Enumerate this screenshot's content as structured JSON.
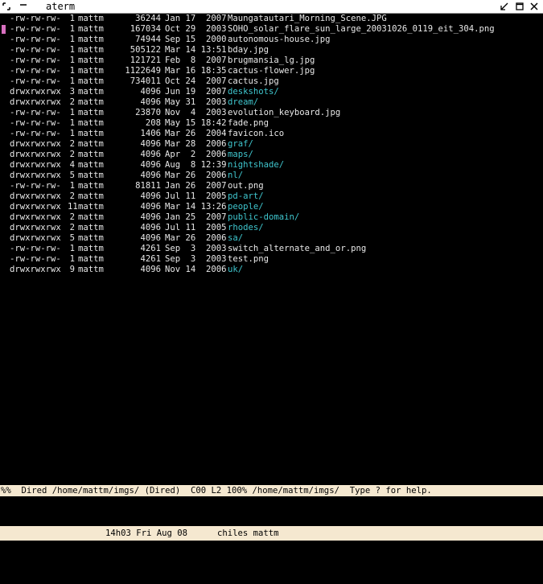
{
  "window": {
    "title": "aterm"
  },
  "listing": [
    {
      "perms": "-rw-rw-rw-",
      "links": "1",
      "owner": "mattm",
      "size": "36244",
      "date": "Jan 17  2007",
      "name": "Maungatautari_Morning_Scene.JPG",
      "dir": false
    },
    {
      "perms": "-rw-rw-rw-",
      "links": "1",
      "owner": "mattm",
      "size": "167034",
      "date": "Oct 29  2003",
      "name": "SOHO_solar_flare_sun_large_20031026_0119_eit_304.png",
      "dir": false
    },
    {
      "perms": "-rw-rw-rw-",
      "links": "1",
      "owner": "mattm",
      "size": "74944",
      "date": "Sep 15  2000",
      "name": "autonomous-house.jpg",
      "dir": false
    },
    {
      "perms": "-rw-rw-rw-",
      "links": "1",
      "owner": "mattm",
      "size": "505122",
      "date": "Mar 14 13:51",
      "name": "bday.jpg",
      "dir": false
    },
    {
      "perms": "-rw-rw-rw-",
      "links": "1",
      "owner": "mattm",
      "size": "121721",
      "date": "Feb  8  2007",
      "name": "brugmansia_lg.jpg",
      "dir": false
    },
    {
      "perms": "-rw-rw-rw-",
      "links": "1",
      "owner": "mattm",
      "size": "1122649",
      "date": "Mar 16 18:35",
      "name": "cactus-flower.jpg",
      "dir": false
    },
    {
      "perms": "-rw-rw-rw-",
      "links": "1",
      "owner": "mattm",
      "size": "734011",
      "date": "Oct 24  2007",
      "name": "cactus.jpg",
      "dir": false
    },
    {
      "perms": "drwxrwxrwx",
      "links": "3",
      "owner": "mattm",
      "size": "4096",
      "date": "Jun 19  2007",
      "name": "deskshots/",
      "dir": true
    },
    {
      "perms": "drwxrwxrwx",
      "links": "2",
      "owner": "mattm",
      "size": "4096",
      "date": "May 31  2003",
      "name": "dream/",
      "dir": true
    },
    {
      "perms": "-rw-rw-rw-",
      "links": "1",
      "owner": "mattm",
      "size": "23870",
      "date": "Nov  4  2003",
      "name": "evolution_keyboard.jpg",
      "dir": false
    },
    {
      "perms": "-rw-rw-rw-",
      "links": "1",
      "owner": "mattm",
      "size": "208",
      "date": "May 15 18:42",
      "name": "fade.png",
      "dir": false
    },
    {
      "perms": "-rw-rw-rw-",
      "links": "1",
      "owner": "mattm",
      "size": "1406",
      "date": "Mar 26  2004",
      "name": "favicon.ico",
      "dir": false
    },
    {
      "perms": "drwxrwxrwx",
      "links": "2",
      "owner": "mattm",
      "size": "4096",
      "date": "Mar 28  2006",
      "name": "graf/",
      "dir": true
    },
    {
      "perms": "drwxrwxrwx",
      "links": "2",
      "owner": "mattm",
      "size": "4096",
      "date": "Apr  2  2006",
      "name": "maps/",
      "dir": true
    },
    {
      "perms": "drwxrwxrwx",
      "links": "4",
      "owner": "mattm",
      "size": "4096",
      "date": "Aug  8 12:39",
      "name": "nightshade/",
      "dir": true
    },
    {
      "perms": "drwxrwxrwx",
      "links": "5",
      "owner": "mattm",
      "size": "4096",
      "date": "Mar 26  2006",
      "name": "nl/",
      "dir": true
    },
    {
      "perms": "-rw-rw-rw-",
      "links": "1",
      "owner": "mattm",
      "size": "81811",
      "date": "Jan 26  2007",
      "name": "out.png",
      "dir": false
    },
    {
      "perms": "drwxrwxrwx",
      "links": "2",
      "owner": "mattm",
      "size": "4096",
      "date": "Jul 11  2005",
      "name": "pd-art/",
      "dir": true
    },
    {
      "perms": "drwxrwxrwx",
      "links": "11",
      "owner": "mattm",
      "size": "4096",
      "date": "Mar 14 13:26",
      "name": "people/",
      "dir": true
    },
    {
      "perms": "drwxrwxrwx",
      "links": "2",
      "owner": "mattm",
      "size": "4096",
      "date": "Jan 25  2007",
      "name": "public-domain/",
      "dir": true
    },
    {
      "perms": "drwxrwxrwx",
      "links": "2",
      "owner": "mattm",
      "size": "4096",
      "date": "Jul 11  2005",
      "name": "rhodes/",
      "dir": true
    },
    {
      "perms": "drwxrwxrwx",
      "links": "5",
      "owner": "mattm",
      "size": "4096",
      "date": "Mar 26  2006",
      "name": "sa/",
      "dir": true
    },
    {
      "perms": "-rw-rw-rw-",
      "links": "1",
      "owner": "mattm",
      "size": "4261",
      "date": "Sep  3  2003",
      "name": "switch_alternate_and_or.png",
      "dir": false
    },
    {
      "perms": "-rw-rw-rw-",
      "links": "1",
      "owner": "mattm",
      "size": "4261",
      "date": "Sep  3  2003",
      "name": "test.png",
      "dir": false
    },
    {
      "perms": "drwxrwxrwx",
      "links": "9",
      "owner": "mattm",
      "size": "4096",
      "date": "Nov 14  2006",
      "name": "uk/",
      "dir": true
    }
  ],
  "cursor_row": 1,
  "modeline": {
    "text": "%%  Dired /home/mattm/imgs/ (Dired)  C00 L2 100% /home/mattm/imgs/  Type ? for help."
  },
  "statusbar": {
    "clock": "14h03 Fri Aug 08",
    "user": "chiles mattm"
  },
  "colors": {
    "background": "#000000",
    "text": "#e8e8e8",
    "directory": "#3fc6ce",
    "cursor": "#d870c0",
    "modeline_bg": "#f5e8d0"
  },
  "icons": {
    "window_menu": "window-menu-icon",
    "iconify": "iconify-icon",
    "maximize": "maximize-icon",
    "close": "close-icon"
  }
}
